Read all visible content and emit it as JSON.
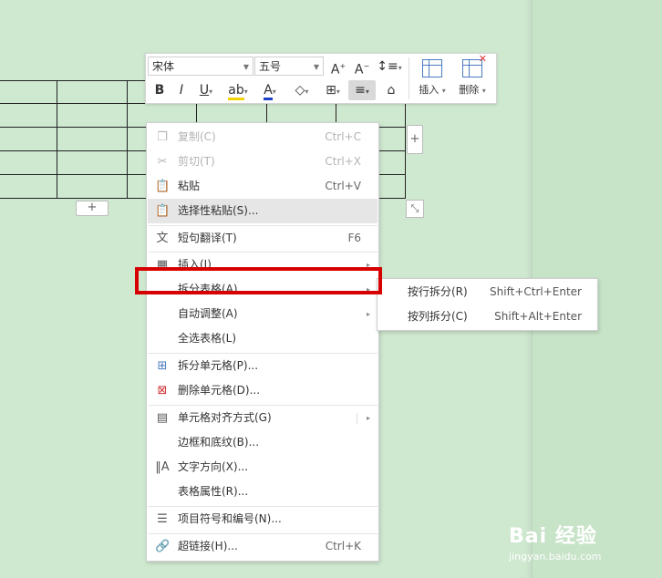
{
  "toolbar": {
    "font_name": "宋体",
    "font_size": "五号",
    "insert_label": "插入",
    "delete_label": "删除",
    "icons": [
      "grow-font-icon",
      "shrink-font-icon",
      "line-spacing-icon",
      "bold-icon",
      "italic-icon",
      "underline-icon",
      "highlight-icon",
      "font-color-icon",
      "shading-icon",
      "borders-icon",
      "align-icon",
      "format-painter-icon"
    ],
    "font_color": "#1e3fc7"
  },
  "menu": {
    "items": [
      {
        "label": "复制(C)",
        "shortcut": "Ctrl+C",
        "disabled": true
      },
      {
        "label": "剪切(T)",
        "shortcut": "Ctrl+X",
        "disabled": true
      },
      {
        "label": "粘贴",
        "shortcut": "Ctrl+V"
      },
      {
        "label": "选择性粘贴(S)..."
      },
      {
        "label": "短句翻译(T)",
        "shortcut": "F6"
      },
      {
        "label": "插入(I)"
      },
      {
        "label": "拆分表格(A)"
      },
      {
        "label": "自动调整(A)"
      },
      {
        "label": "全选表格(L)"
      },
      {
        "label": "拆分单元格(P)..."
      },
      {
        "label": "删除单元格(D)..."
      },
      {
        "label": "单元格对齐方式(G)"
      },
      {
        "label": "边框和底纹(B)..."
      },
      {
        "label": "文字方向(X)..."
      },
      {
        "label": "表格属性(R)..."
      },
      {
        "label": "项目符号和编号(N)..."
      },
      {
        "label": "超链接(H)...",
        "shortcut": "Ctrl+K"
      }
    ]
  },
  "submenu": {
    "items": [
      {
        "label": "按行拆分(R)",
        "shortcut": "Shift+Ctrl+Enter"
      },
      {
        "label": "按列拆分(C)",
        "shortcut": "Shift+Alt+Enter"
      }
    ]
  },
  "table": {
    "add_col": "+",
    "add_row": "+"
  },
  "watermark": {
    "brand": "Bai 经验",
    "url": "jingyan.baidu.com"
  },
  "colors": {
    "highlight_box": "#d60000",
    "page_bg": "#cfe8d0"
  }
}
